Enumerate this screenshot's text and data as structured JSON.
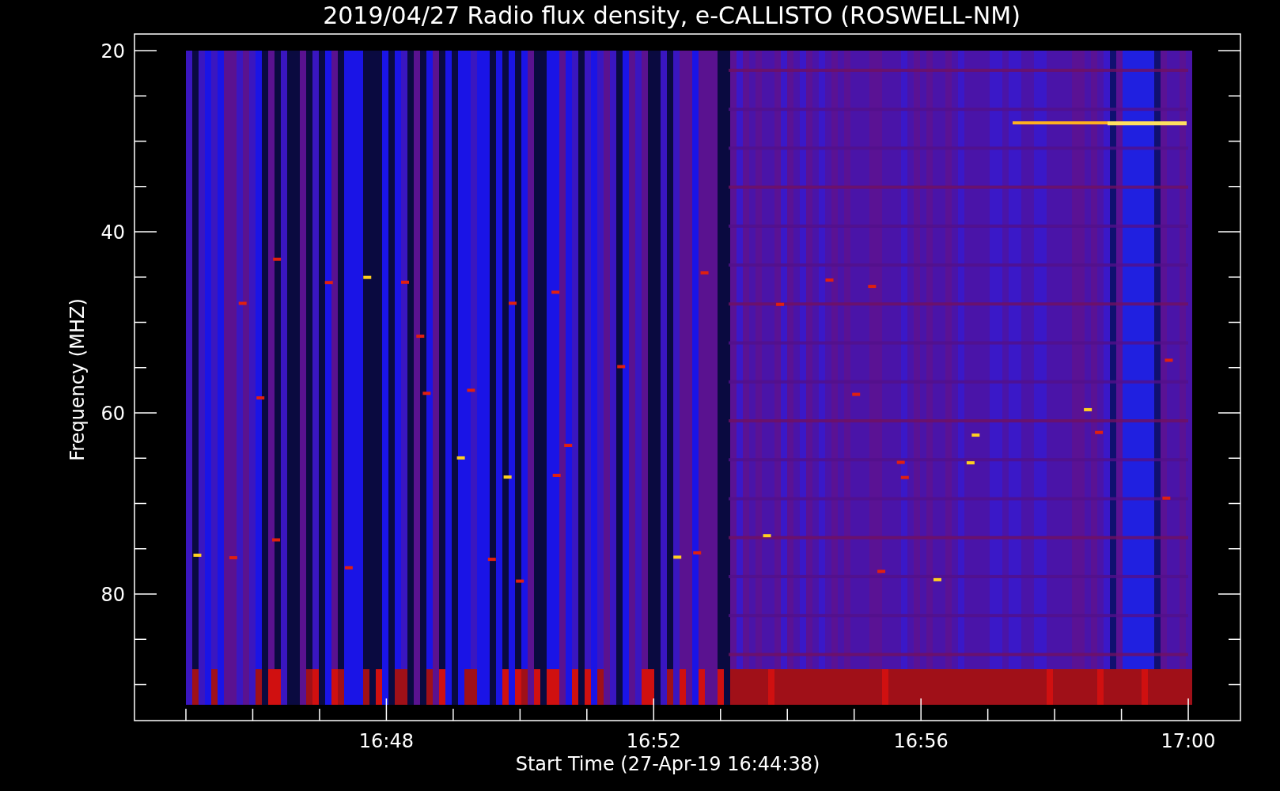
{
  "plot": {
    "title": "2019/04/27  Radio flux density, e-CALLISTO (ROSWELL-NM)",
    "ylabel": "Frequency (MHZ)",
    "xlabel": "Start Time (27-Apr-19 16:44:38)",
    "y_ticks": [
      "20",
      "40",
      "60",
      "80"
    ],
    "x_ticks": [
      "16:48",
      "16:52",
      "16:56",
      "17:00"
    ]
  }
}
